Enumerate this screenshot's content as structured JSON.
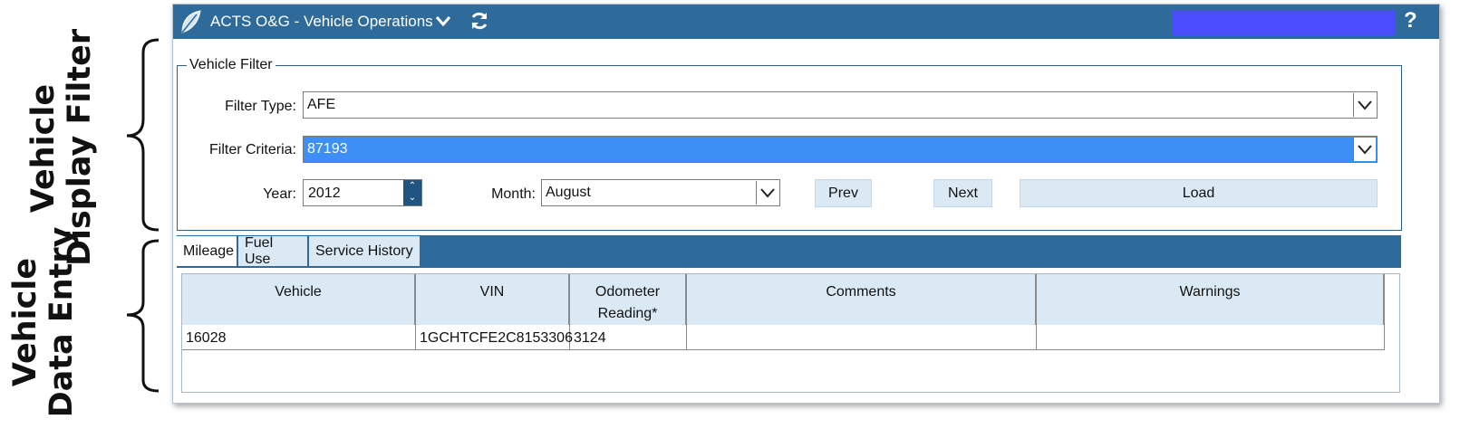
{
  "annotations": {
    "filter_line1": "Vehicle",
    "filter_line2": "Display Filter",
    "entry_line1": "Vehicle",
    "entry_line2": "Data Entry"
  },
  "titlebar": {
    "title": "ACTS O&G - Vehicle Operations",
    "icons": [
      "leaf-logo-icon",
      "chevron-down-icon",
      "refresh-icon",
      "help-icon"
    ],
    "help": "?",
    "color": "#2e6a9a",
    "user_box_color": "#4a4cff"
  },
  "filter": {
    "legend": "Vehicle Filter",
    "filter_type_label": "Filter Type:",
    "filter_type_value": "AFE",
    "filter_criteria_label": "Filter Criteria:",
    "filter_criteria_value": "87193",
    "year_label": "Year:",
    "year_value": "2012",
    "month_label": "Month:",
    "month_value": "August",
    "prev_label": "Prev",
    "next_label": "Next",
    "load_label": "Load"
  },
  "tabs": [
    {
      "label": "Mileage",
      "active": true
    },
    {
      "label": "Fuel Use",
      "active": false
    },
    {
      "label": "Service History",
      "active": false
    }
  ],
  "grid": {
    "columns": [
      "Vehicle",
      "VIN",
      "Odometer\nReading*",
      "Comments",
      "Warnings"
    ],
    "rows": [
      [
        "16028",
        "1GCHTCFE2C8153306",
        "3124",
        "",
        ""
      ]
    ]
  }
}
